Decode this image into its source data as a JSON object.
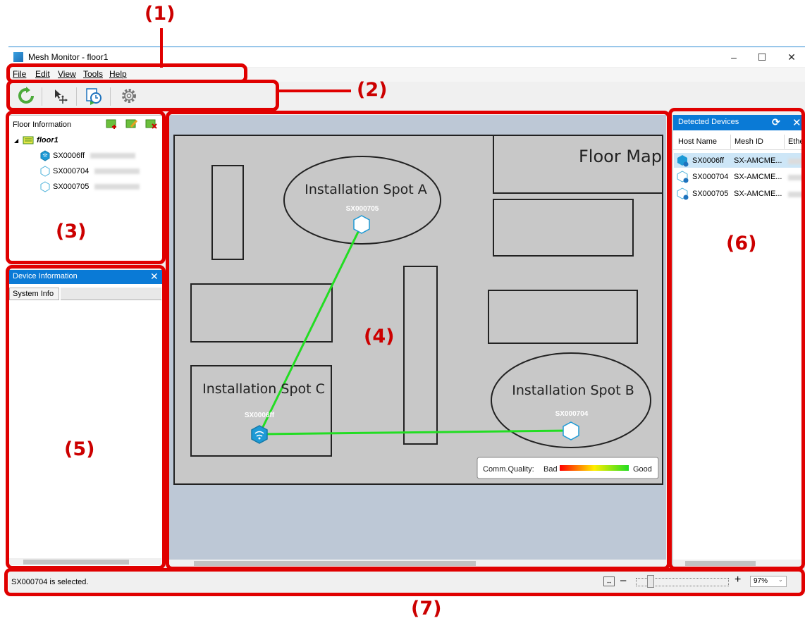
{
  "callouts": {
    "c1": "(1)",
    "c2": "(2)",
    "c3": "(3)",
    "c4": "(4)",
    "c5": "(5)",
    "c6": "(6)",
    "c7": "(7)"
  },
  "window": {
    "title": "Mesh Monitor - floor1",
    "minimize": "–",
    "maximize": "☐",
    "close": "✕"
  },
  "menu": {
    "file": "File",
    "edit": "Edit",
    "view": "View",
    "tools": "Tools",
    "help": "Help"
  },
  "toolbar": {
    "icons": [
      "refresh-icon",
      "move-cursor-icon",
      "history-icon",
      "gear-icon"
    ]
  },
  "floor_info": {
    "title": "Floor Information",
    "root": "floor1",
    "devices": [
      "SX0006ff",
      "SX000704",
      "SX000705"
    ]
  },
  "device_info": {
    "title": "Device Information",
    "close": "✕",
    "tab": "System Info"
  },
  "map": {
    "title": "Floor Map",
    "spot_a": "Installation Spot A",
    "spot_b": "Installation Spot B",
    "spot_c": "Installation Spot C",
    "node_a": "SX000705",
    "node_b": "SX000704",
    "node_c": "SX0006ff",
    "legend_label": "Comm.Quality:",
    "legend_bad": "Bad",
    "legend_good": "Good",
    "link_color": "#22dd22"
  },
  "detected": {
    "title": "Detected Devices",
    "refresh": "⟳",
    "close": "✕",
    "columns": [
      "Host Name",
      "Mesh ID",
      "Ether"
    ],
    "rows": [
      {
        "host": "SX0006ff",
        "mesh": "SX-AMCME..."
      },
      {
        "host": "SX000704",
        "mesh": "SX-AMCME..."
      },
      {
        "host": "SX000705",
        "mesh": "SX-AMCME..."
      }
    ]
  },
  "status": {
    "message": "SX000704 is selected.",
    "zoom_minus": "–",
    "zoom_plus": "+",
    "zoom_value": "97%"
  }
}
